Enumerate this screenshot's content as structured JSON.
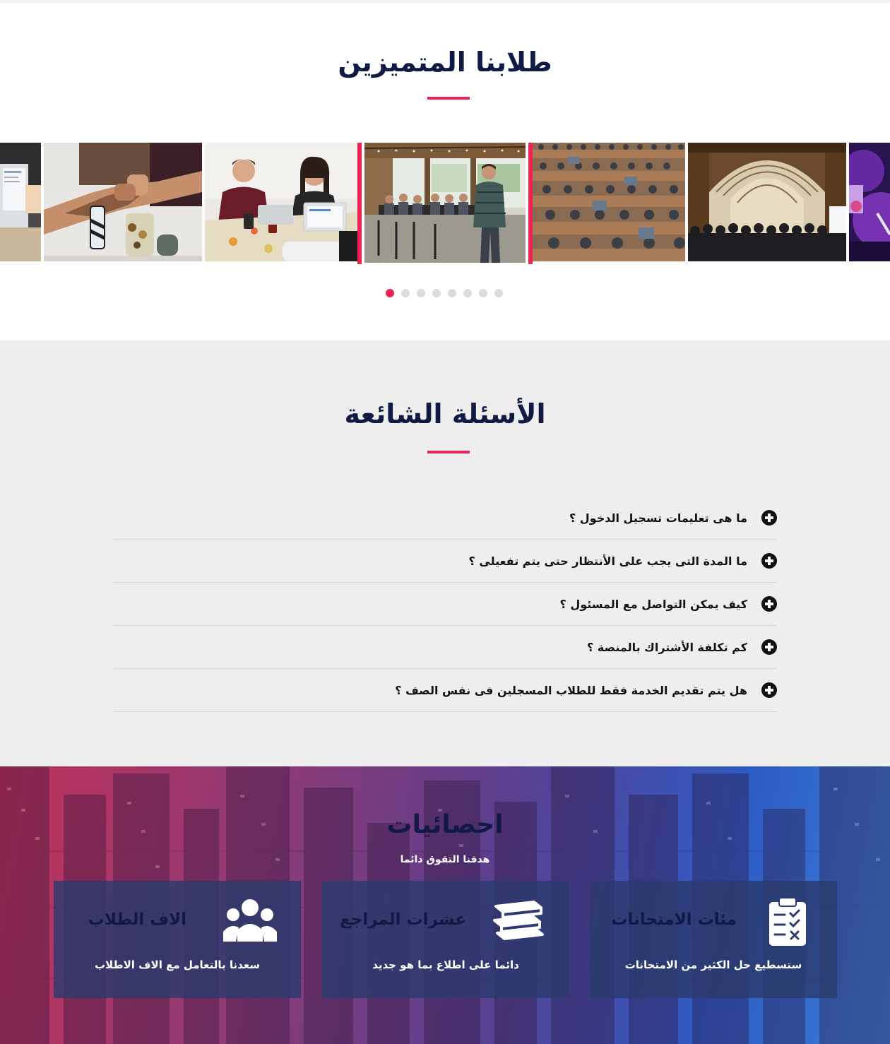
{
  "students": {
    "title": "طلابنا المتميزين",
    "slides": [
      {
        "name": "laptop-workspace",
        "active": false
      },
      {
        "name": "team-fist-bump",
        "active": false
      },
      {
        "name": "office-meeting",
        "active": false
      },
      {
        "name": "speaker-presentation",
        "active": true
      },
      {
        "name": "lecture-hall-audience",
        "active": false
      },
      {
        "name": "exhibition-hall",
        "active": false
      },
      {
        "name": "concert-stage",
        "active": false
      }
    ],
    "dots": 8,
    "active_dot": 0,
    "accent_color": "#ec2354"
  },
  "faq": {
    "title": "الأسئلة الشائعة",
    "items": [
      {
        "question": "ما هى تعليمات تسجيل الدخول ؟"
      },
      {
        "question": "ما المدة التى يجب على الأنتظار حتى يتم تفعيلى ؟"
      },
      {
        "question": "كيف يمكن التواصل مع المسئول ؟"
      },
      {
        "question": "كم تكلفة الأشتراك بالمنصة ؟"
      },
      {
        "question": "هل يتم تقديم الخدمة فقط للطلاب المسجلين فى نفس الصف ؟"
      }
    ],
    "icon": "plus-circle-icon"
  },
  "stats": {
    "title": "احصائيات",
    "subtitle": "هدفنا التفوق دائما",
    "cards": [
      {
        "icon": "clipboard-check-icon",
        "title": "مئات الامتحانات",
        "desc": "ستسطيع حل الكثير من الامتحانات"
      },
      {
        "icon": "books-icon",
        "title": "عشرات المراجع",
        "desc": "دائما على اطلاع بما هو جديد"
      },
      {
        "icon": "users-icon",
        "title": "الاف الطلاب",
        "desc": "سعدنا بالتعامل مع الاف الاطلاب"
      }
    ]
  }
}
